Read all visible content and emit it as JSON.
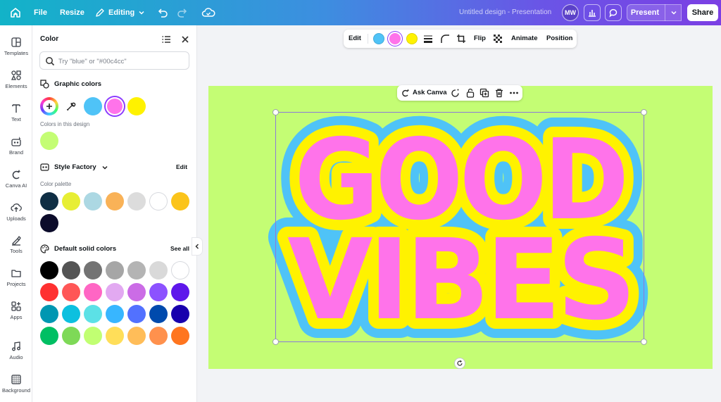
{
  "topbar": {
    "file": "File",
    "resize": "Resize",
    "editing": "Editing",
    "title": "Untitled design - Presentation",
    "avatar": "MW",
    "present": "Present",
    "share": "Share"
  },
  "rail": {
    "items": [
      {
        "label": "Templates",
        "icon": "templates-icon"
      },
      {
        "label": "Elements",
        "icon": "elements-icon"
      },
      {
        "label": "Text",
        "icon": "text-icon"
      },
      {
        "label": "Brand",
        "icon": "brand-icon"
      },
      {
        "label": "Canva AI",
        "icon": "canva-ai-icon"
      },
      {
        "label": "Uploads",
        "icon": "uploads-icon"
      },
      {
        "label": "Tools",
        "icon": "tools-icon"
      },
      {
        "label": "Projects",
        "icon": "projects-icon"
      },
      {
        "label": "Apps",
        "icon": "apps-icon"
      },
      {
        "label": "Audio",
        "icon": "audio-icon"
      },
      {
        "label": "Background",
        "icon": "background-icon"
      }
    ]
  },
  "panel": {
    "title": "Color",
    "search_placeholder": "Try \"blue\" or \"#00c4cc\"",
    "graphic_colors": {
      "label": "Graphic colors",
      "colors": [
        "#4fc3f7",
        "#ff73ea",
        "#fff200"
      ]
    },
    "in_design": {
      "label": "Colors in this design",
      "colors": [
        "#c4fd74"
      ]
    },
    "style_factory": {
      "label": "Style Factory",
      "edit": "Edit",
      "palette_label": "Color palette",
      "colors": [
        "#0f2e44",
        "#e7ee34",
        "#acd8e3",
        "#f9b257",
        "#dcdcdc",
        "#ffffff",
        "#fbc41b",
        "#0b0b2a"
      ]
    },
    "default_colors": {
      "label": "Default solid colors",
      "see_all": "See all",
      "rows": [
        [
          "#000000",
          "#545454",
          "#737373",
          "#a6a6a6",
          "#b4b4b4",
          "#d9d9d9",
          "#ffffff"
        ],
        [
          "#ff3131",
          "#ff5757",
          "#ff66c4",
          "#e2a9f1",
          "#cb6ce6",
          "#8c52ff",
          "#5e17eb"
        ],
        [
          "#0097b2",
          "#0cc0df",
          "#5ce1e6",
          "#38b6ff",
          "#5271ff",
          "#004aad",
          "#1800ad"
        ],
        [
          "#00bf63",
          "#7ed957",
          "#c1ff72",
          "#ffde59",
          "#ffbd59",
          "#ff914d",
          "#ff751f"
        ]
      ]
    }
  },
  "context_toolbar": {
    "edit": "Edit",
    "colors": [
      "#4fc3f7",
      "#ff73ea",
      "#fff200"
    ],
    "flip": "Flip",
    "animate": "Animate",
    "position": "Position"
  },
  "ask_bar": {
    "label": "Ask Canva"
  },
  "canvas": {
    "background": "#c4fd74",
    "line1": "GOOD",
    "line2": "VIBES",
    "fill": "#ff73ea",
    "outline1": "#fff200",
    "outline2": "#4fc3f7"
  }
}
